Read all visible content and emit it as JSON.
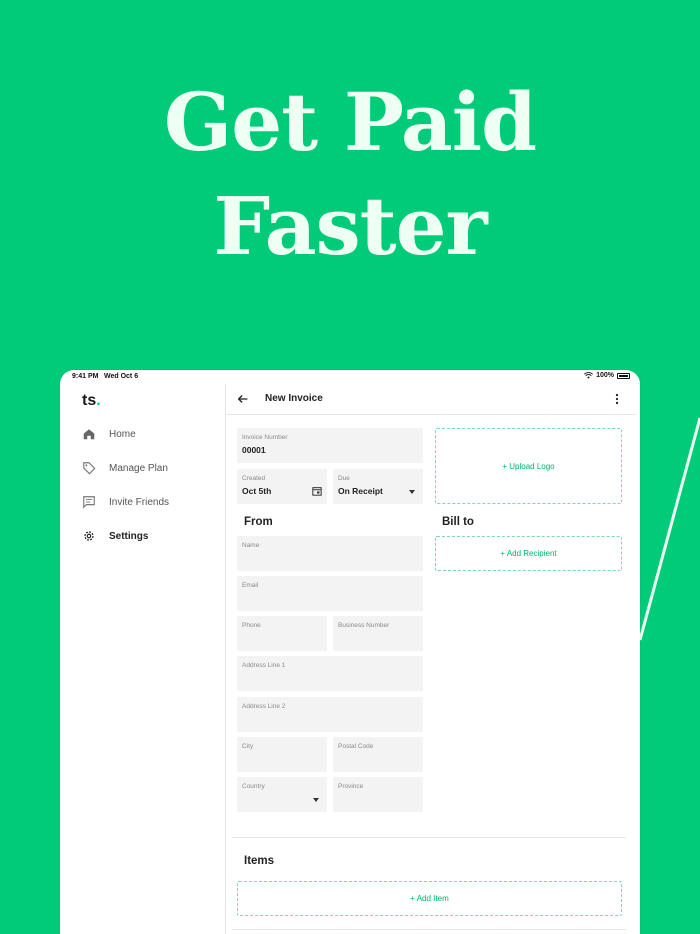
{
  "hero": {
    "line1": "Get Paid",
    "line2": "Faster"
  },
  "status_bar": {
    "time": "9:41 PM",
    "date": "Wed Oct 6",
    "battery": "100%"
  },
  "sidebar": {
    "logo_text": "ts",
    "logo_dot": ".",
    "items": [
      {
        "label": "Home",
        "icon": "home-icon"
      },
      {
        "label": "Manage Plan",
        "icon": "tag-icon"
      },
      {
        "label": "Invite Friends",
        "icon": "chat-icon"
      },
      {
        "label": "Settings",
        "icon": "gear-icon"
      }
    ]
  },
  "topbar": {
    "title": "New Invoice"
  },
  "invoice": {
    "number_label": "Invoice Number",
    "number_value": "00001",
    "created_label": "Created",
    "created_value": "Oct 5th",
    "due_label": "Due",
    "due_value": "On Receipt",
    "upload_logo": "+ Upload Logo"
  },
  "from": {
    "title": "From",
    "name": "Name",
    "email": "Email",
    "phone": "Phone",
    "business_number": "Business Number",
    "address1": "Address Line 1",
    "address2": "Address Line 2",
    "city": "City",
    "postal": "Postal Code",
    "country": "Country",
    "province": "Province"
  },
  "bill_to": {
    "title": "Bill to",
    "add_recipient": "+ Add Recipient"
  },
  "items": {
    "title": "Items",
    "add_item": "+ Add Item"
  },
  "colors": {
    "brand": "#00CB78",
    "hero_text": "#EEFFF4",
    "dashed_border": "#7FD9AE"
  }
}
